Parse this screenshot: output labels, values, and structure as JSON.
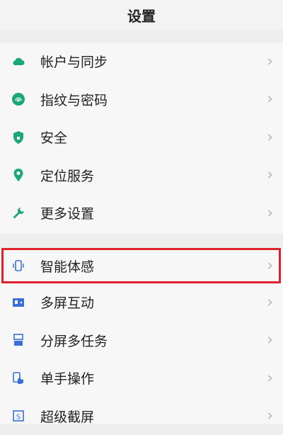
{
  "header": {
    "title": "设置"
  },
  "group1": [
    {
      "label": "帐户与同步",
      "icon": "cloud-icon"
    },
    {
      "label": "指纹与密码",
      "icon": "fingerprint-icon"
    },
    {
      "label": "安全",
      "icon": "shield-icon"
    },
    {
      "label": "定位服务",
      "icon": "location-pin-icon"
    },
    {
      "label": "更多设置",
      "icon": "wrench-icon"
    }
  ],
  "group2": [
    {
      "label": "智能体感",
      "icon": "phone-motion-icon"
    },
    {
      "label": "多屏互动",
      "icon": "multi-screen-icon"
    },
    {
      "label": "分屏多任务",
      "icon": "split-screen-icon"
    },
    {
      "label": "单手操作",
      "icon": "one-hand-icon"
    },
    {
      "label": "超级截屏",
      "icon": "screenshot-icon"
    }
  ],
  "chevron": "›",
  "colors": {
    "green": "#1aa877",
    "blue": "#3a6fd8",
    "highlight": "#e0202a"
  }
}
